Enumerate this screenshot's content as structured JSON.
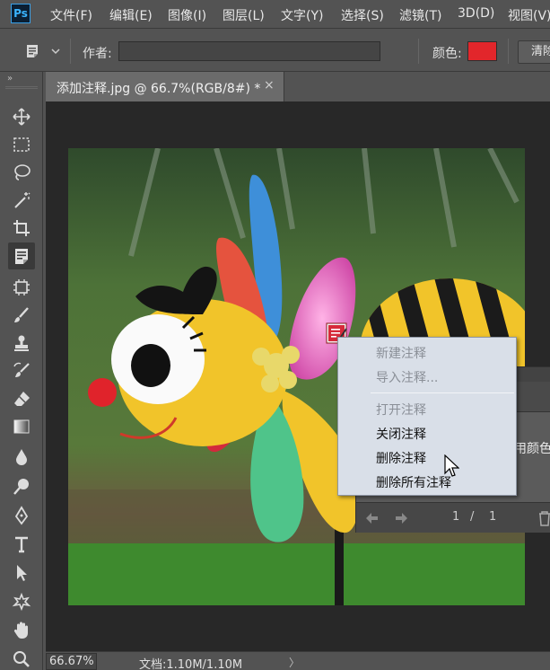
{
  "app": {
    "logo_text": "Ps"
  },
  "menu": {
    "items": [
      "文件(F)",
      "编辑(E)",
      "图像(I)",
      "图层(L)",
      "文字(Y)",
      "选择(S)",
      "滤镜(T)",
      "3D(D)",
      "视图(V)"
    ]
  },
  "options": {
    "tool_icon": "note-tool-icon",
    "author_label": "作者:",
    "author_value": "",
    "color_label": "颜色:",
    "color_value": "#e2262b",
    "clear_label": "清除"
  },
  "tools": {
    "collapse_glyph": "»",
    "items": [
      "move-tool-icon",
      "marquee-tool-icon",
      "lasso-tool-icon",
      "magic-wand-tool-icon",
      "crop-tool-icon",
      "note-tool-icon",
      "frame-tool-icon",
      "brush-tool-icon",
      "stamp-tool-icon",
      "history-brush-tool-icon",
      "eraser-tool-icon",
      "gradient-tool-icon",
      "blur-tool-icon",
      "dodge-tool-icon",
      "pen-tool-icon",
      "type-tool-icon",
      "path-select-tool-icon",
      "custom-shape-tool-icon",
      "hand-tool-icon",
      "zoom-tool-icon"
    ],
    "active": "note-tool-icon"
  },
  "document": {
    "tab_label": "添加注释.jpg @ 66.7%(RGB/8#) *",
    "close_glyph": "×"
  },
  "notes_panel": {
    "body_text": "用颜色显",
    "current": "1",
    "separator": "/",
    "total": "1"
  },
  "context_menu": {
    "items": [
      {
        "label": "新建注释",
        "enabled": false
      },
      {
        "label": "导入注释...",
        "enabled": false
      },
      {
        "label": "打开注释",
        "enabled": false
      },
      {
        "label": "关闭注释",
        "enabled": true
      },
      {
        "label": "删除注释",
        "enabled": true
      },
      {
        "label": "删除所有注释",
        "enabled": true
      }
    ]
  },
  "status": {
    "zoom": "66.67%",
    "doc_size": "文档:1.10M/1.10M",
    "arrow": "〉"
  }
}
